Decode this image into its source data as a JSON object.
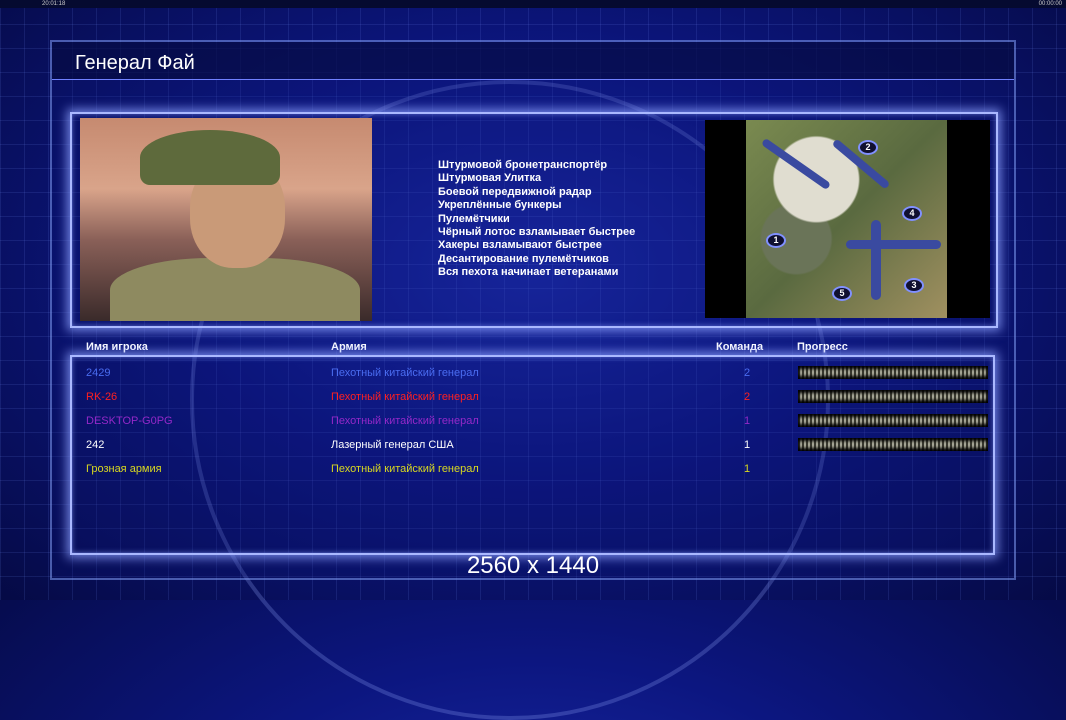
{
  "topbar": {
    "left_time": "20:01:18",
    "right_time": "00:00:00"
  },
  "title": "Генерал Фай",
  "perks": [
    "Штурмовой бронетранспортёр",
    "Штурмовая Улитка",
    "Боевой передвижной радар",
    "Укреплённые бункеры",
    "Пулемётчики",
    "Чёрный лотос взламывает быстрее",
    "Хакеры взламывают быстрее",
    "Десантирование пулемётчиков",
    "Вся пехота начинает ветеранами"
  ],
  "map": {
    "markers": [
      "1",
      "2",
      "3",
      "4",
      "5"
    ]
  },
  "table": {
    "headers": {
      "name": "Имя игрока",
      "army": "Армия",
      "team": "Команда",
      "progress": "Прогресс"
    },
    "rows": [
      {
        "name": "2429",
        "army": "Пехотный китайский генерал",
        "team": "2",
        "color": "#4a6cf0",
        "progress": 1
      },
      {
        "name": "RK-26",
        "army": "Пехотный китайский генерал",
        "team": "2",
        "color": "#ff2020",
        "progress": 1
      },
      {
        "name": "DESKTOP-G0PG",
        "army": "Пехотный китайский генерал",
        "team": "1",
        "color": "#9428c8",
        "progress": 1
      },
      {
        "name": "242",
        "army": "Лазерный генерал США",
        "team": "1",
        "color": "#ffffff",
        "progress": 1
      },
      {
        "name": "Грозная армия",
        "army": "Пехотный китайский генерал",
        "team": "1",
        "color": "#d8d820",
        "progress": null
      }
    ]
  },
  "resolution": "2560 x 1440"
}
